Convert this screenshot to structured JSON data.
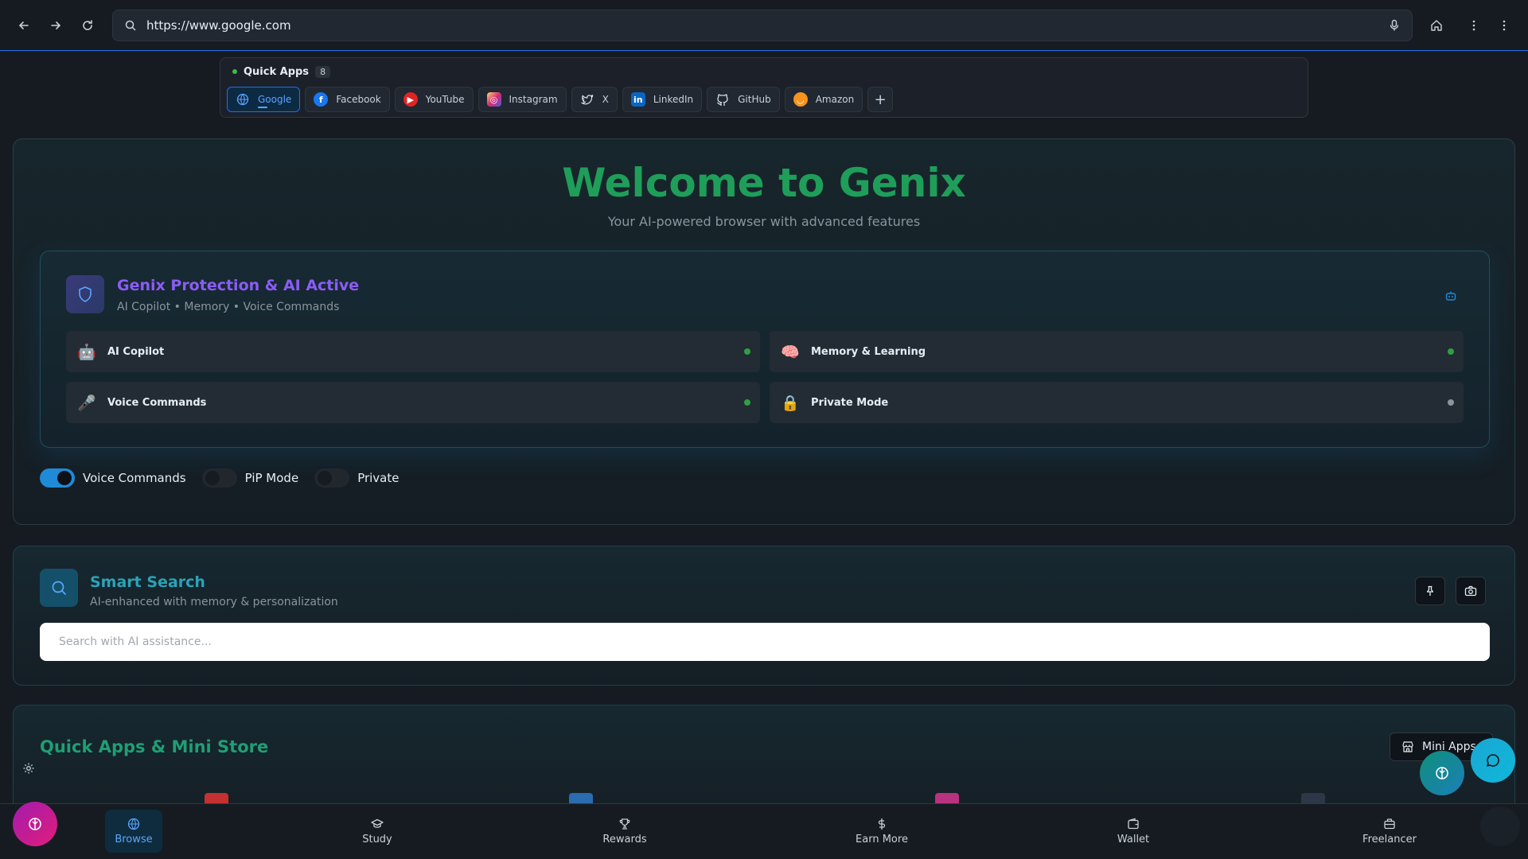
{
  "browser": {
    "url": "https://www.google.com"
  },
  "quick_apps": {
    "title": "Quick Apps",
    "count": "8",
    "items": [
      {
        "label": "Google",
        "icon": "globe-icon",
        "color": "#1f6feb"
      },
      {
        "label": "Facebook",
        "icon": "facebook-icon",
        "color": "#1877f2"
      },
      {
        "label": "YouTube",
        "icon": "youtube-icon",
        "color": "#ff0000"
      },
      {
        "label": "Instagram",
        "icon": "instagram-icon",
        "color": "#d62976"
      },
      {
        "label": "X",
        "icon": "twitter-icon",
        "color": "#e6edf3"
      },
      {
        "label": "LinkedIn",
        "icon": "linkedin-icon",
        "color": "#0a66c2"
      },
      {
        "label": "GitHub",
        "icon": "github-icon",
        "color": "#e6edf3"
      },
      {
        "label": "Amazon",
        "icon": "amazon-icon",
        "color": "#ff9900"
      }
    ],
    "add_label": "+"
  },
  "welcome": {
    "title": "Welcome to Genix",
    "subtitle": "Your AI-powered browser with advanced features"
  },
  "protection": {
    "title": "Genix Protection & AI Active",
    "subtitle": "AI Copilot • Memory • Voice Commands",
    "features": [
      {
        "label": "AI Copilot",
        "emoji": "🤖",
        "status_color": "#2ea043"
      },
      {
        "label": "Memory & Learning",
        "emoji": "🧠",
        "status_color": "#2ea043"
      },
      {
        "label": "Voice Commands",
        "emoji": "🎤",
        "status_color": "#2ea043"
      },
      {
        "label": "Private Mode",
        "emoji": "🔒",
        "status_color": "#8b949e"
      }
    ]
  },
  "toggles": [
    {
      "label": "Voice Commands",
      "on": true
    },
    {
      "label": "PiP Mode",
      "on": false
    },
    {
      "label": "Private",
      "on": false
    }
  ],
  "smart_search": {
    "title": "Smart Search",
    "subtitle": "AI-enhanced with memory & personalization",
    "placeholder": "Search with AI assistance..."
  },
  "mini_store": {
    "title": "Quick Apps & Mini Store",
    "button_label": "Mini Apps"
  },
  "bottom_nav": [
    {
      "label": "Browse",
      "icon": "globe-icon",
      "active": true
    },
    {
      "label": "Study",
      "icon": "graduation-cap-icon",
      "active": false
    },
    {
      "label": "Rewards",
      "icon": "trophy-icon",
      "active": false
    },
    {
      "label": "Earn More",
      "icon": "dollar-icon",
      "active": false
    },
    {
      "label": "Wallet",
      "icon": "wallet-icon",
      "active": false
    },
    {
      "label": "Freelancer",
      "icon": "briefcase-icon",
      "active": false
    }
  ],
  "colors": {
    "accent": "#1f6feb",
    "welcome_title": "#1f9e5a",
    "protection_title": "#8b5cf6",
    "search_title": "#2aa3b8"
  }
}
